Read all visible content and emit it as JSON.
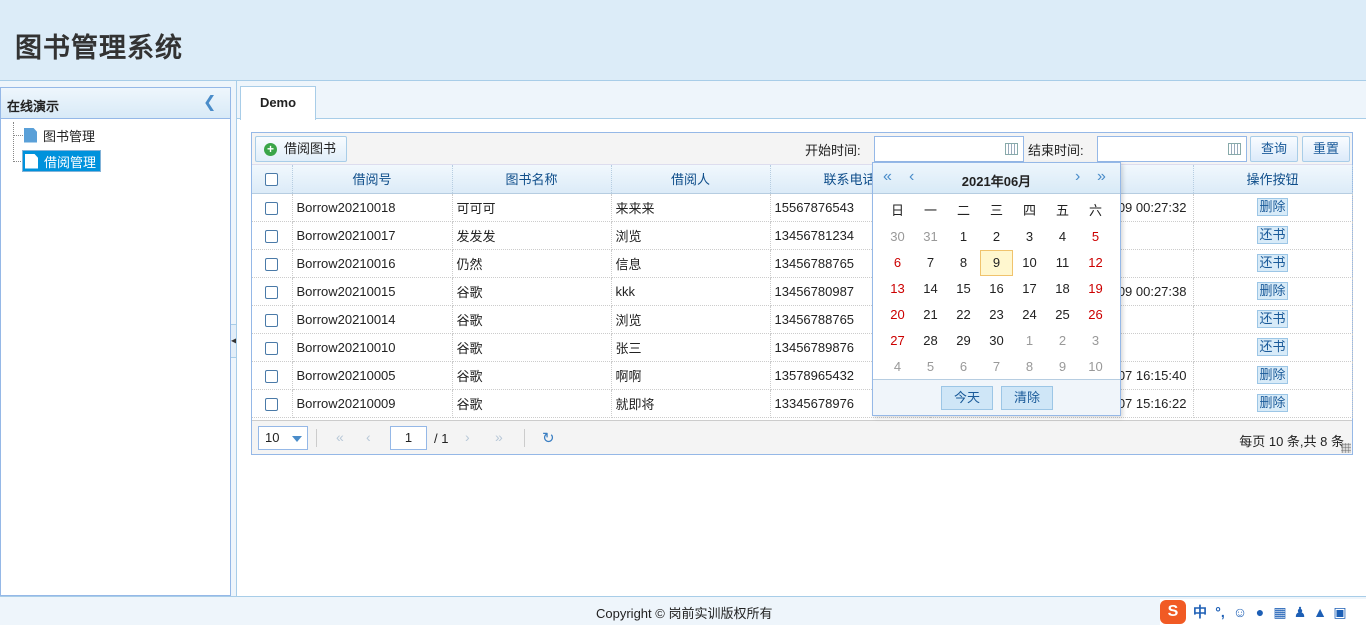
{
  "app": {
    "title": "图书管理系统"
  },
  "sidebar": {
    "title": "在线演示",
    "items": [
      {
        "label": "图书管理"
      },
      {
        "label": "借阅管理"
      }
    ]
  },
  "tabs": [
    {
      "label": "Demo"
    }
  ],
  "toolbar": {
    "add_label": "借阅图书",
    "start_label": "开始时间:",
    "end_label": "结束时间:",
    "start_value": "",
    "end_value": "",
    "search_label": "查询",
    "reset_label": "重置"
  },
  "table": {
    "columns": [
      "借阅号",
      "图书名称",
      "借阅人",
      "联系电话",
      "",
      "操作按钮"
    ],
    "rows": [
      {
        "id": "Borrow20210018",
        "book": "可可可",
        "person": "来来来",
        "phone": "15567876543",
        "time": "09 00:27:32",
        "op": "删除"
      },
      {
        "id": "Borrow20210017",
        "book": "发发发",
        "person": "浏览",
        "phone": "13456781234",
        "time": "",
        "op": "还书"
      },
      {
        "id": "Borrow20210016",
        "book": "仍然",
        "person": "信息",
        "phone": "13456788765",
        "time": "",
        "op": "还书"
      },
      {
        "id": "Borrow20210015",
        "book": "谷歌",
        "person": "kkk",
        "phone": "13456780987",
        "time": "09 00:27:38",
        "op": "删除"
      },
      {
        "id": "Borrow20210014",
        "book": "谷歌",
        "person": "浏览",
        "phone": "13456788765",
        "time": "",
        "op": "还书"
      },
      {
        "id": "Borrow20210010",
        "book": "谷歌",
        "person": "张三",
        "phone": "13456789876",
        "time": "",
        "op": "还书"
      },
      {
        "id": "Borrow20210005",
        "book": "谷歌",
        "person": "啊啊",
        "phone": "13578965432",
        "time": "07 16:15:40",
        "op": "删除"
      },
      {
        "id": "Borrow20210009",
        "book": "谷歌",
        "person": "就即将",
        "phone": "13345678976",
        "time": "07 15:16:22",
        "op": "删除"
      }
    ]
  },
  "pager": {
    "page_size": "10",
    "page": "1",
    "page_of": "/ 1",
    "info": "每页 10 条,共 8 条"
  },
  "datepicker": {
    "month": "2021年06月",
    "weekdays": [
      "日",
      "一",
      "二",
      "三",
      "四",
      "五",
      "六"
    ],
    "weeks": [
      [
        "30",
        "31",
        "1",
        "2",
        "3",
        "4",
        "5"
      ],
      [
        "6",
        "7",
        "8",
        "9",
        "10",
        "11",
        "12"
      ],
      [
        "13",
        "14",
        "15",
        "16",
        "17",
        "18",
        "19"
      ],
      [
        "20",
        "21",
        "22",
        "23",
        "24",
        "25",
        "26"
      ],
      [
        "27",
        "28",
        "29",
        "30",
        "1",
        "2",
        "3"
      ],
      [
        "4",
        "5",
        "6",
        "7",
        "8",
        "9",
        "10"
      ]
    ],
    "today_label": "今天",
    "clear_label": "清除"
  },
  "footer": {
    "copyright": "Copyright © 岗前实训版权所有"
  },
  "ime": {
    "lang": "中",
    "punct": "°,"
  },
  "colors": {
    "accent": "#0092dc",
    "header_bg": "#dcecf8",
    "border": "#95b8e7",
    "weekend": "#cc0000"
  }
}
